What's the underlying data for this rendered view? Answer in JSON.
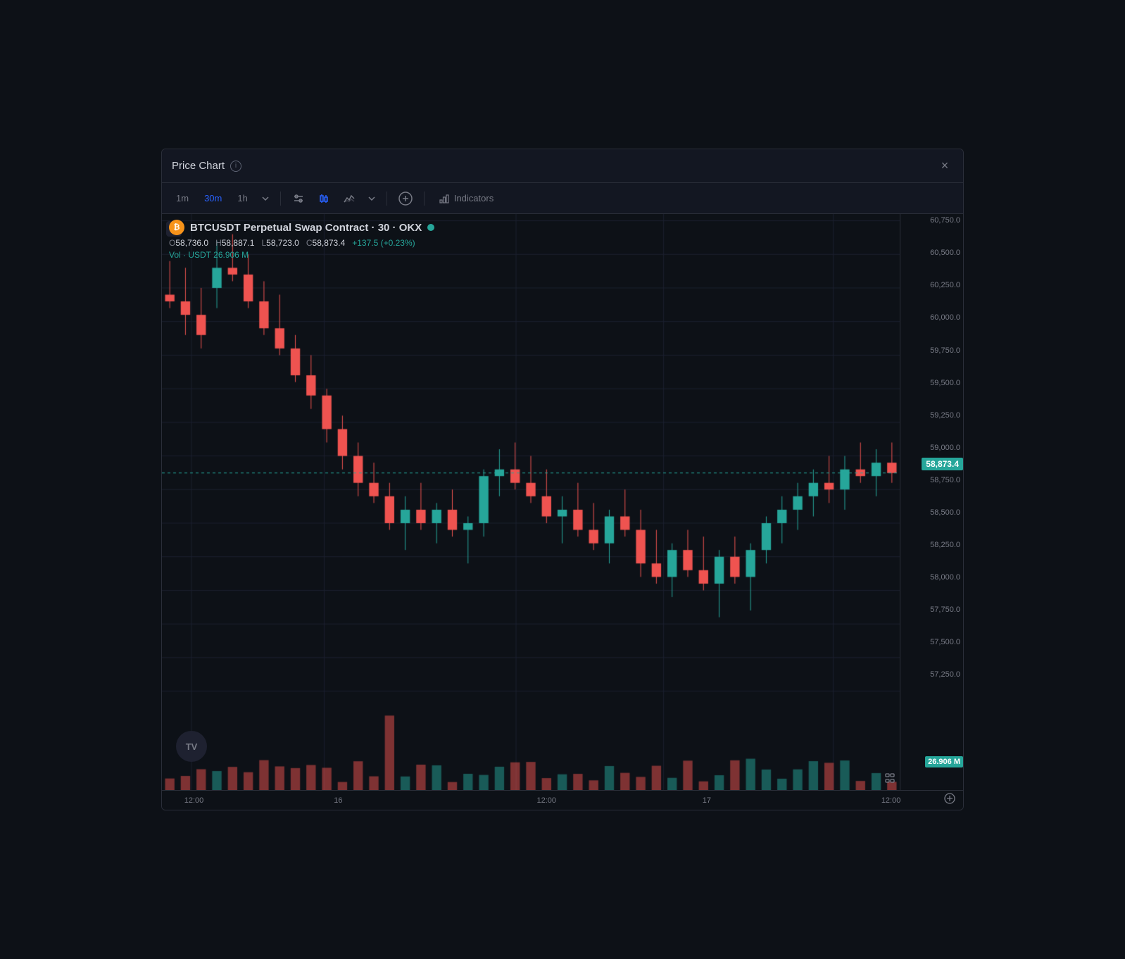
{
  "window": {
    "title": "Price Chart",
    "close_label": "×"
  },
  "toolbar": {
    "timeframes": [
      {
        "label": "1m",
        "active": false
      },
      {
        "label": "30m",
        "active": true
      },
      {
        "label": "1h",
        "active": false
      }
    ],
    "indicators_label": "Indicators",
    "plus_label": "+"
  },
  "chart": {
    "symbol": "BTCUSDT Perpetual Swap Contract · 30 · OKX",
    "open": "58,736.0",
    "high": "58,887.1",
    "low": "58,723.0",
    "close": "58,873.4",
    "change": "+137.5 (+0.23%)",
    "volume_label": "Vol · USDT",
    "volume_value": "26.906 M",
    "current_price": "58,873.4",
    "current_vol": "26.906 M",
    "price_levels": [
      "60,750.0",
      "60,500.0",
      "60,250.0",
      "60,000.0",
      "59,750.0",
      "59,500.0",
      "59,250.0",
      "59,000.0",
      "58,750.0",
      "58,500.0",
      "58,250.0",
      "58,000.0",
      "57,750.0",
      "57,500.0",
      "57,250.0"
    ],
    "time_labels": [
      "12:00",
      "16",
      "12:00",
      "17",
      "12:00"
    ],
    "colors": {
      "bg": "#0d1117",
      "up": "#26a69a",
      "down": "#ef5350",
      "vol_up": "#26a69a",
      "vol_down": "#ef5350",
      "current_price_bg": "#26a69a",
      "grid": "#1c2030"
    }
  }
}
